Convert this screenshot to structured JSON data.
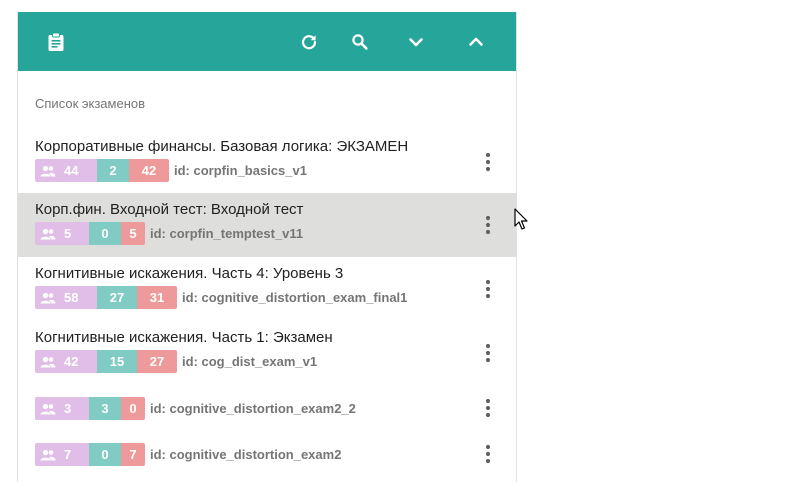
{
  "toolbar": {
    "icons": [
      "clipboard-icon",
      "refresh-icon",
      "search-icon",
      "chevron-down-icon",
      "chevron-up-icon"
    ],
    "color": "#26a69a"
  },
  "list": {
    "section_title": "Список экзаменов",
    "colors": {
      "users": "#e1bee7",
      "passed": "#80cbc4",
      "failed": "#ef9a9a",
      "active_row": "#dededc"
    },
    "items": [
      {
        "title": "Корпоративные финансы. Базовая логика: ЭКЗАМЕН",
        "users": "44",
        "passed": "2",
        "failed": "42",
        "id": "id: corpfin_basics_v1",
        "active": false
      },
      {
        "title": "Корп.фин. Входной тест: Входной тест",
        "users": "5",
        "passed": "0",
        "failed": "5",
        "id": "id: corpfin_temptest_v11",
        "active": true
      },
      {
        "title": "Когнитивные искажения. Часть 4: Уровень 3",
        "users": "58",
        "passed": "27",
        "failed": "31",
        "id": "id: cognitive_distortion_exam_final1",
        "active": false
      },
      {
        "title": "Когнитивные искажения. Часть 1: Экзамен",
        "users": "42",
        "passed": "15",
        "failed": "27",
        "id": "id: cog_dist_exam_v1",
        "active": false
      },
      {
        "title": "",
        "users": "3",
        "passed": "3",
        "failed": "0",
        "id": "id: cognitive_distortion_exam2_2",
        "active": false
      },
      {
        "title": "",
        "users": "7",
        "passed": "0",
        "failed": "7",
        "id": "id: cognitive_distortion_exam2",
        "active": false
      }
    ]
  }
}
